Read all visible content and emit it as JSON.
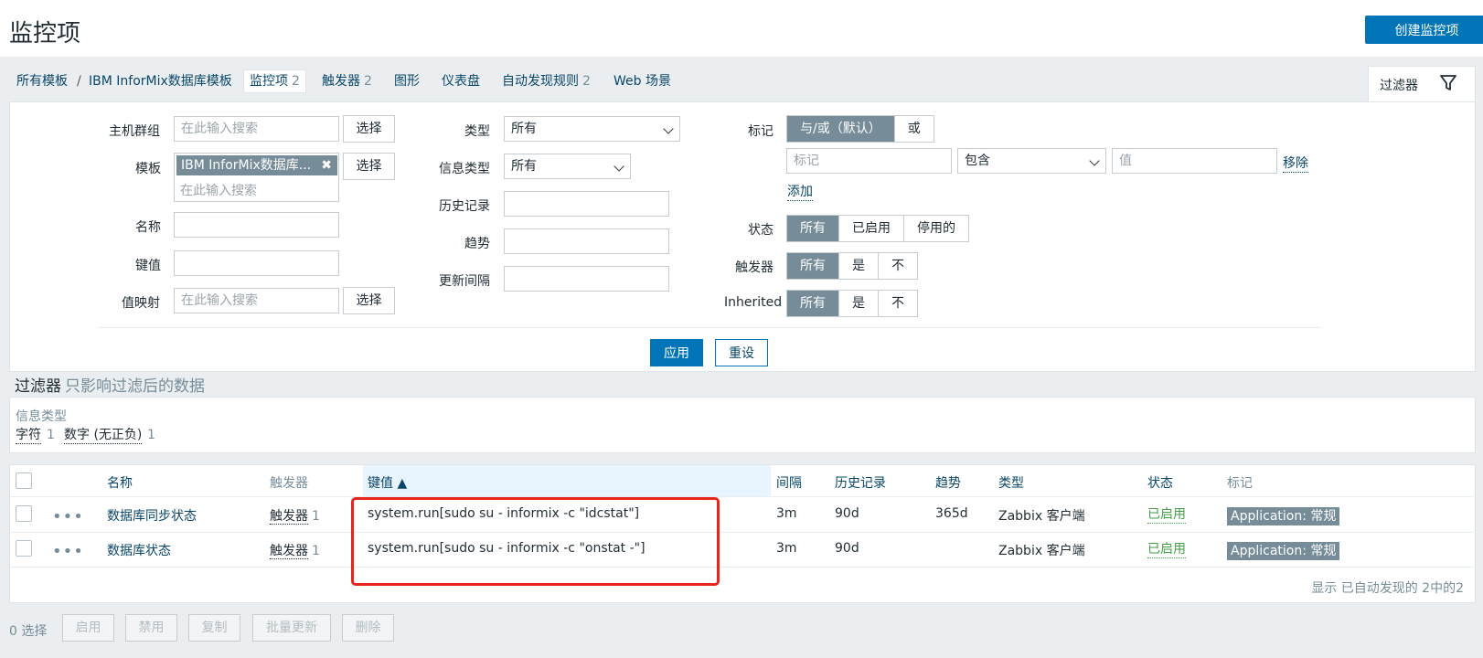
{
  "header": {
    "title": "监控项",
    "create_button": "创建监控项"
  },
  "nav": {
    "all_templates": "所有模板",
    "separator": "/",
    "template": "IBM InforMix数据库模板",
    "items_label": "监控项",
    "items_count": "2",
    "triggers_label": "触发器",
    "triggers_count": "2",
    "graphs": "图形",
    "dashboards": "仪表盘",
    "discovery_label": "自动发现规则",
    "discovery_count": "2",
    "web": "Web 场景",
    "filter_tab": "过滤器"
  },
  "filter": {
    "host_groups_label": "主机群组",
    "host_groups_placeholder": "在此输入搜索",
    "select": "选择",
    "templates_label": "模板",
    "template_chip": "IBM InforMix数据库...",
    "templates_placeholder": "在此输入搜索",
    "name_label": "名称",
    "key_label": "键值",
    "valuemap_label": "值映射",
    "valuemap_placeholder": "在此输入搜索",
    "type_label": "类型",
    "type_value": "所有",
    "info_type_label": "信息类型",
    "info_type_value": "所有",
    "history_label": "历史记录",
    "trends_label": "趋势",
    "interval_label": "更新间隔",
    "tags_label": "标记",
    "tags_andor": "与/或（默认）",
    "tags_or": "或",
    "tag_placeholder": "标记",
    "tag_operator": "包含",
    "tag_value_placeholder": "值",
    "remove": "移除",
    "add": "添加",
    "status_label": "状态",
    "status_options": [
      "所有",
      "已启用",
      "停用的"
    ],
    "triggers_label": "触发器",
    "triggers_options": [
      "所有",
      "是",
      "不"
    ],
    "inherited_label": "Inherited",
    "inherited_options": [
      "所有",
      "是",
      "不"
    ],
    "apply": "应用",
    "reset": "重设"
  },
  "subfilter": {
    "title": "过滤器",
    "note": "只影响过滤后的数据",
    "category": "信息类型",
    "items": [
      {
        "label": "字符",
        "count": "1"
      },
      {
        "label": "数字 (无正负)",
        "count": "1"
      }
    ]
  },
  "table": {
    "columns": {
      "name": "名称",
      "triggers": "触发器",
      "key": "键值 ▲",
      "interval": "间隔",
      "history": "历史记录",
      "trends": "趋势",
      "type": "类型",
      "status": "状态",
      "tags": "标记"
    },
    "rows": [
      {
        "menu": "•••",
        "name": "数据库同步状态",
        "triggers": "触发器",
        "triggers_count": "1",
        "key": "system.run[sudo su - informix -c \"idcstat\"]",
        "interval": "3m",
        "history": "90d",
        "trends": "365d",
        "type": "Zabbix 客户端",
        "status": "已启用",
        "tag": "Application: 常规"
      },
      {
        "menu": "•••",
        "name": "数据库状态",
        "triggers": "触发器",
        "triggers_count": "1",
        "key": "system.run[sudo su - informix -c \"onstat -\"]",
        "interval": "3m",
        "history": "90d",
        "trends": "",
        "type": "Zabbix 客户端",
        "status": "已启用",
        "tag": "Application: 常规"
      }
    ],
    "footer": "显示 已自动发现的 2中的2"
  },
  "actions": {
    "selected": "0 选择",
    "buttons": [
      "启用",
      "禁用",
      "复制",
      "批量更新",
      "删除"
    ]
  },
  "colors": {
    "primary": "#0275b8",
    "link": "#0a466a",
    "enabled": "#429e47",
    "tag_bg": "#768d99",
    "highlight": "#e8251d"
  }
}
